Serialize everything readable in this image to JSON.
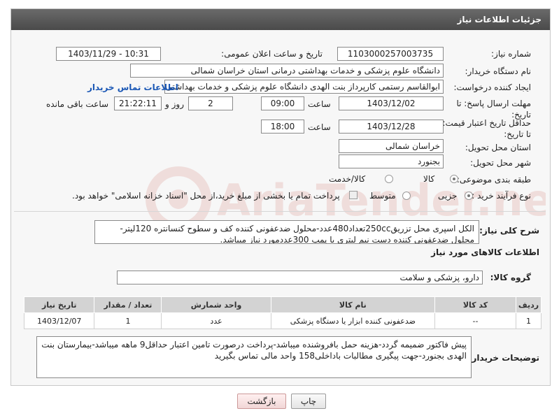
{
  "header": {
    "title": "جزئیات اطلاعات نیاز"
  },
  "fields": {
    "need_number": {
      "label": "شماره نیاز:",
      "value": "1103000257003735"
    },
    "announce_datetime": {
      "label": "تاریخ و ساعت اعلان عمومی:",
      "value": "1403/11/29 - 10:31"
    },
    "buyer_org": {
      "label": "نام دستگاه خریدار:",
      "value": "دانشگاه علوم پزشکی و خدمات بهداشتی درمانی استان خراسان شمالی"
    },
    "requester": {
      "label": "ایجاد کننده درخواست:",
      "value": "ابوالقاسم رستمی کارپرداز بنت الهدی دانشگاه علوم پزشکی و خدمات بهداشتی",
      "contact_link": "اطلاعات تماس خریدار"
    },
    "reply_deadline": {
      "label": "مهلت ارسال پاسخ: تا تاریخ:",
      "date": "1403/12/02",
      "time_label": "ساعت",
      "time": "09:00",
      "days": "2",
      "days_label": "روز و",
      "remaining": "21:22:11",
      "remaining_label": "ساعت باقی مانده"
    },
    "price_validity": {
      "label": "حداقل تاریخ اعتبار قیمت: تا تاریخ:",
      "date": "1403/12/28",
      "time_label": "ساعت",
      "time": "18:00"
    },
    "delivery_province": {
      "label": "استان محل تحویل:",
      "value": "خراسان شمالی"
    },
    "delivery_city": {
      "label": "شهر محل تحویل:",
      "value": "بجنورد"
    },
    "category": {
      "label": "طبقه بندی موضوعی:",
      "options": [
        "کالا",
        "کالا/خدمت"
      ],
      "selected": "کالا"
    },
    "purchase_process": {
      "label": "نوع فرآیند خرید :",
      "options": [
        "جزیی",
        "متوسط"
      ],
      "selected": "جزیی",
      "note": "پرداخت تمام یا بخشی از مبلغ خرید،از محل \"اسناد خزانه اسلامی\" خواهد بود."
    }
  },
  "description": {
    "label": "شرح کلی نیاز:",
    "text": "الکل اسپری محل تزریق250ccتعداد480عدد-محلول ضدعفونی کننده کف و سطوح کنسانتره 120لیتر-محلول ضدعفونی کننده دست نیم لیتری با پمپ 300عددمورد نیاز میباشد."
  },
  "goods_section": {
    "title": "اطلاعات کالاهای مورد نیاز",
    "group_label": "گروه کالا:",
    "group_value": "دارو، پزشکی و سلامت",
    "table": {
      "headers": [
        "ردیف",
        "کد کالا",
        "نام کالا",
        "واحد شمارش",
        "تعداد / مقدار",
        "تاریخ نیاز"
      ],
      "rows": [
        [
          "1",
          "--",
          "ضدعفونی کننده ابزار یا دستگاه پزشکی",
          "عدد",
          "1",
          "1403/12/07"
        ]
      ]
    }
  },
  "buyer_notes": {
    "label": "توضیحات خریدار:",
    "text": "پیش فاکتور ضمیمه گردد-هزینه حمل بافروشنده میباشد-پرداخت درصورت تامین اعتبار حداقل9 ماهه میباشد-بیمارستان بنت الهدی بجنورد-جهت پیگیری مطالبات باداخلی158 واحد مالی تماس بگیرید"
  },
  "buttons": {
    "print": "چاپ",
    "back": "بازگشت"
  },
  "watermark": {
    "text": "AriaTender.neT"
  },
  "colors": {
    "header_bg": "#555555",
    "link": "#1a57b5",
    "table_header": "#d3d3d3",
    "watermark": "#c0392b"
  }
}
